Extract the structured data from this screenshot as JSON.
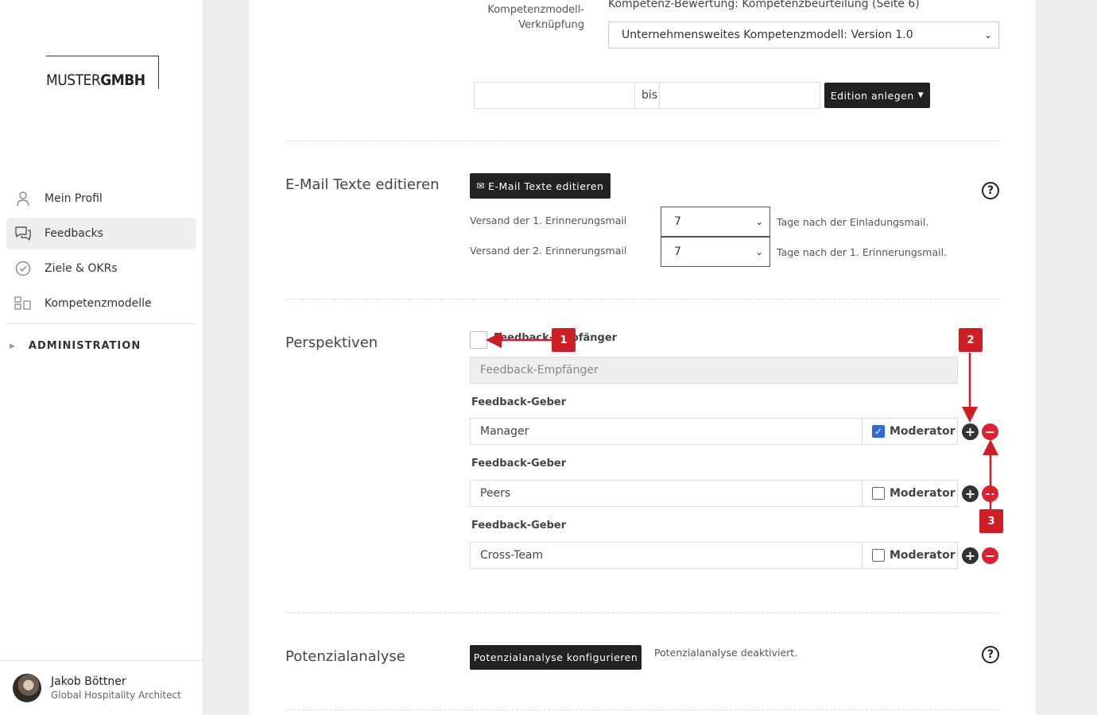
{
  "brand": {
    "logo_left": "MUSTER",
    "logo_right": "GMBH"
  },
  "sidebar": {
    "items": [
      {
        "label": "Mein Profil",
        "icon": "user-icon"
      },
      {
        "label": "Feedbacks",
        "icon": "chat-icon"
      },
      {
        "label": "Ziele & OKRs",
        "icon": "check-circle-icon"
      },
      {
        "label": "Kompetenzmodelle",
        "icon": "blocks-icon"
      }
    ],
    "admin_label": "ADMINISTRATION"
  },
  "user": {
    "name": "Jakob Böttner",
    "role": "Global Hospitality Architect"
  },
  "kompetenz": {
    "label_line1": "Kompetenzmodell-",
    "label_line2": "Verknüpfung",
    "top_text": "Kompetenz-Bewertung: Kompetenzbeurteilung (Seite 6)",
    "select_value": "Unternehmensweites Kompetenzmodell: Version 1.0",
    "range_separator": "bis",
    "edition_button": "Edition anlegen"
  },
  "email": {
    "title": "E-Mail Texte editieren",
    "button": "E-Mail Texte editieren",
    "reminder1_label": "Versand der 1. Erinnerungsmail",
    "reminder1_value": "7",
    "reminder1_suffix": "Tage nach der Einladungsmail.",
    "reminder2_label": "Versand der 2. Erinnerungsmail",
    "reminder2_value": "7",
    "reminder2_suffix": "Tage nach der 1. Erinnerungsmail."
  },
  "perspektiven": {
    "title": "Perspektiven",
    "empfaenger_check_label": "Feedback-Empfänger",
    "empfaenger_input": "Feedback-Empfänger",
    "geber_label": "Feedback-Geber",
    "moderator_label": "Moderator",
    "rows": [
      {
        "value": "Manager",
        "moderator": true
      },
      {
        "value": "Peers",
        "moderator": false
      },
      {
        "value": "Cross-Team",
        "moderator": false
      }
    ]
  },
  "potenzial": {
    "title": "Potenzialanalyse",
    "button": "Potenzialanalyse konfigurieren",
    "status": "Potenzialanalyse deaktiviert."
  },
  "annotations": {
    "badge1": "1",
    "badge2": "2",
    "badge3": "3",
    "color": "#cc1f26"
  }
}
